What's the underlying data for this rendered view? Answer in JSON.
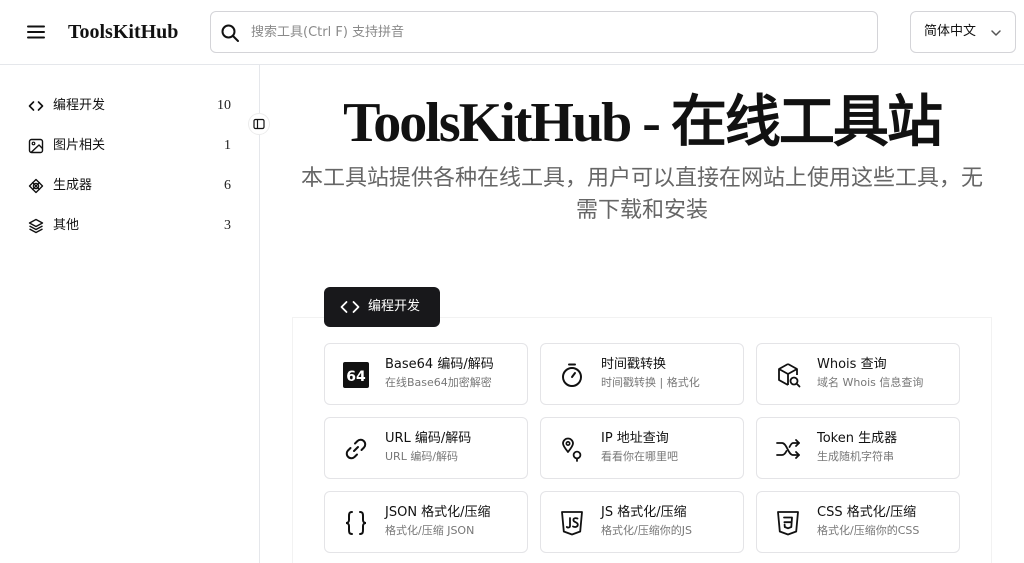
{
  "header": {
    "brand": "ToolsKitHub",
    "search_placeholder": "搜索工具(Ctrl F) 支持拼音",
    "language": "简体中文"
  },
  "sidebar": {
    "items": [
      {
        "label": "编程开发",
        "count": "10",
        "icon": "code-icon"
      },
      {
        "label": "图片相关",
        "count": "1",
        "icon": "image-icon"
      },
      {
        "label": "生成器",
        "count": "6",
        "icon": "generator-icon"
      },
      {
        "label": "其他",
        "count": "3",
        "icon": "layers-icon"
      }
    ]
  },
  "hero": {
    "title": "ToolsKitHub - 在线工具站",
    "subtitle": "本工具站提供各种在线工具，用户可以直接在网站上使用这些工具，无需下载和安装"
  },
  "category": {
    "label": "编程开发",
    "icon": "code-icon"
  },
  "tools": [
    {
      "title": "Base64 编码/解码",
      "desc": "在线Base64加密解密",
      "icon": "base64-icon"
    },
    {
      "title": "时间戳转换",
      "desc": "时间戳转换 | 格式化",
      "icon": "timer-icon"
    },
    {
      "title": "Whois 查询",
      "desc": "域名 Whois 信息查询",
      "icon": "package-search-icon"
    },
    {
      "title": "URL 编码/解码",
      "desc": "URL 编码/解码",
      "icon": "link-icon"
    },
    {
      "title": "IP 地址查询",
      "desc": "看看你在哪里吧",
      "icon": "map-pin-icon"
    },
    {
      "title": "Token 生成器",
      "desc": "生成随机字符串",
      "icon": "shuffle-icon"
    },
    {
      "title": "JSON 格式化/压缩",
      "desc": "格式化/压缩 JSON",
      "icon": "braces-icon"
    },
    {
      "title": "JS 格式化/压缩",
      "desc": "格式化/压缩你的JS",
      "icon": "js-icon"
    },
    {
      "title": "CSS 格式化/压缩",
      "desc": "格式化/压缩你的CSS",
      "icon": "css-icon"
    }
  ]
}
